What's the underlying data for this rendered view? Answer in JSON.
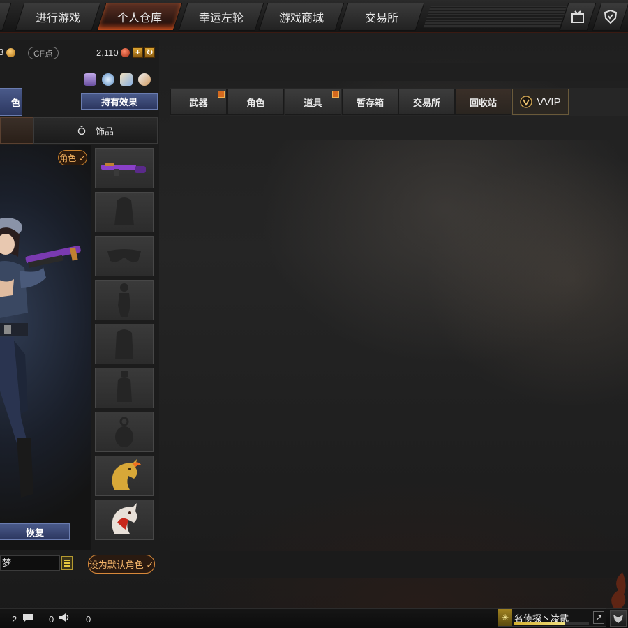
{
  "nav": {
    "tabs": [
      {
        "label": "进行游戏",
        "active": false
      },
      {
        "label": "个人仓库",
        "active": true
      },
      {
        "label": "幸运左轮",
        "active": false
      },
      {
        "label": "游戏商城",
        "active": false
      },
      {
        "label": "交易所",
        "active": false
      }
    ],
    "icons": [
      "tv-icon",
      "shield-icon"
    ]
  },
  "currency": {
    "gold_partial": "3",
    "cf_label": "CF点",
    "points": "2,110"
  },
  "left": {
    "effects_button": "持有效果",
    "top_tab_partial": "色",
    "subtab_accessory": "饰品",
    "role_badge": "角色 ✓",
    "restore_button": "恢复",
    "name_value": "梦",
    "default_role_button": "设为默认角色 ✓",
    "slots": [
      {
        "name": "weapon-slot-rifle",
        "icon": "rifle-icon",
        "filled": true
      },
      {
        "name": "slot-backpack",
        "icon": "backpack-icon",
        "filled": false
      },
      {
        "name": "slot-goggles",
        "icon": "goggles-icon",
        "filled": false
      },
      {
        "name": "slot-character",
        "icon": "figure-icon",
        "filled": false
      },
      {
        "name": "slot-bag",
        "icon": "bag-icon",
        "filled": false
      },
      {
        "name": "slot-grenade",
        "icon": "grenade-icon",
        "filled": false
      },
      {
        "name": "slot-flashbang",
        "icon": "flashbang-icon",
        "filled": false
      },
      {
        "name": "slot-horse-gold",
        "icon": "gold-horse-icon",
        "filled": true
      },
      {
        "name": "slot-horse-red",
        "icon": "red-horse-icon",
        "filled": true
      }
    ]
  },
  "inventory_tabs": [
    {
      "label": "武器",
      "gift": true
    },
    {
      "label": "角色",
      "gift": false
    },
    {
      "label": "道具",
      "gift": true
    },
    {
      "label": "暂存箱",
      "gift": false
    },
    {
      "label": "交易所",
      "gift": false
    },
    {
      "label": "回收站",
      "gift": false,
      "active": true
    },
    {
      "label": "VVIP",
      "gift": false,
      "vvip": true
    }
  ],
  "status": {
    "count1": "2",
    "count2": "0",
    "count3": "0",
    "username": "名侦探丶凌貮",
    "xp_fraction": 0.68
  },
  "colors": {
    "accent_orange": "#d8893a",
    "nav_active": "#7a2a12",
    "button_blue": "#3a4878"
  }
}
